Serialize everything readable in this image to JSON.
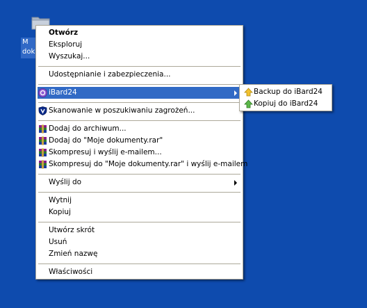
{
  "desktop": {
    "background_color": "#0E4BAE",
    "icon": {
      "name": "folder-icon",
      "label_line1": "M",
      "label_line2": "dok"
    }
  },
  "context_menu": {
    "items": [
      {
        "label": "Otwórz",
        "bold": true
      },
      {
        "label": "Eksploruj"
      },
      {
        "label": "Wyszukaj..."
      },
      {
        "label": "Udostępnianie i zabezpieczenia..."
      },
      {
        "label": "iBard24",
        "icon": "ibard-icon",
        "has_submenu": true,
        "highlighted": true
      },
      {
        "label": "Skanowanie w poszukiwaniu zagrożeń...",
        "icon": "shield-icon"
      },
      {
        "label": "Dodaj do archiwum...",
        "icon": "winrar-icon"
      },
      {
        "label": "Dodaj do \"Moje dokumenty.rar\"",
        "icon": "winrar-icon"
      },
      {
        "label": "Skompresuj i wyślij e-mailem...",
        "icon": "winrar-icon"
      },
      {
        "label": "Skompresuj do \"Moje dokumenty.rar\" i wyślij e-mailem",
        "icon": "winrar-icon"
      },
      {
        "label": "Wyślij do",
        "has_submenu": true
      },
      {
        "label": "Wytnij"
      },
      {
        "label": "Kopiuj"
      },
      {
        "label": "Utwórz skrót"
      },
      {
        "label": "Usuń"
      },
      {
        "label": "Zmień nazwę"
      },
      {
        "label": "Właściwości"
      }
    ]
  },
  "submenu": {
    "items": [
      {
        "label": "Backup do iBard24",
        "icon": "arrow-up-yellow-icon"
      },
      {
        "label": "Kopiuj do iBard24",
        "icon": "arrow-up-green-icon"
      }
    ]
  },
  "colors": {
    "highlight": "#316AC5",
    "menu_border": "#ACA899"
  }
}
